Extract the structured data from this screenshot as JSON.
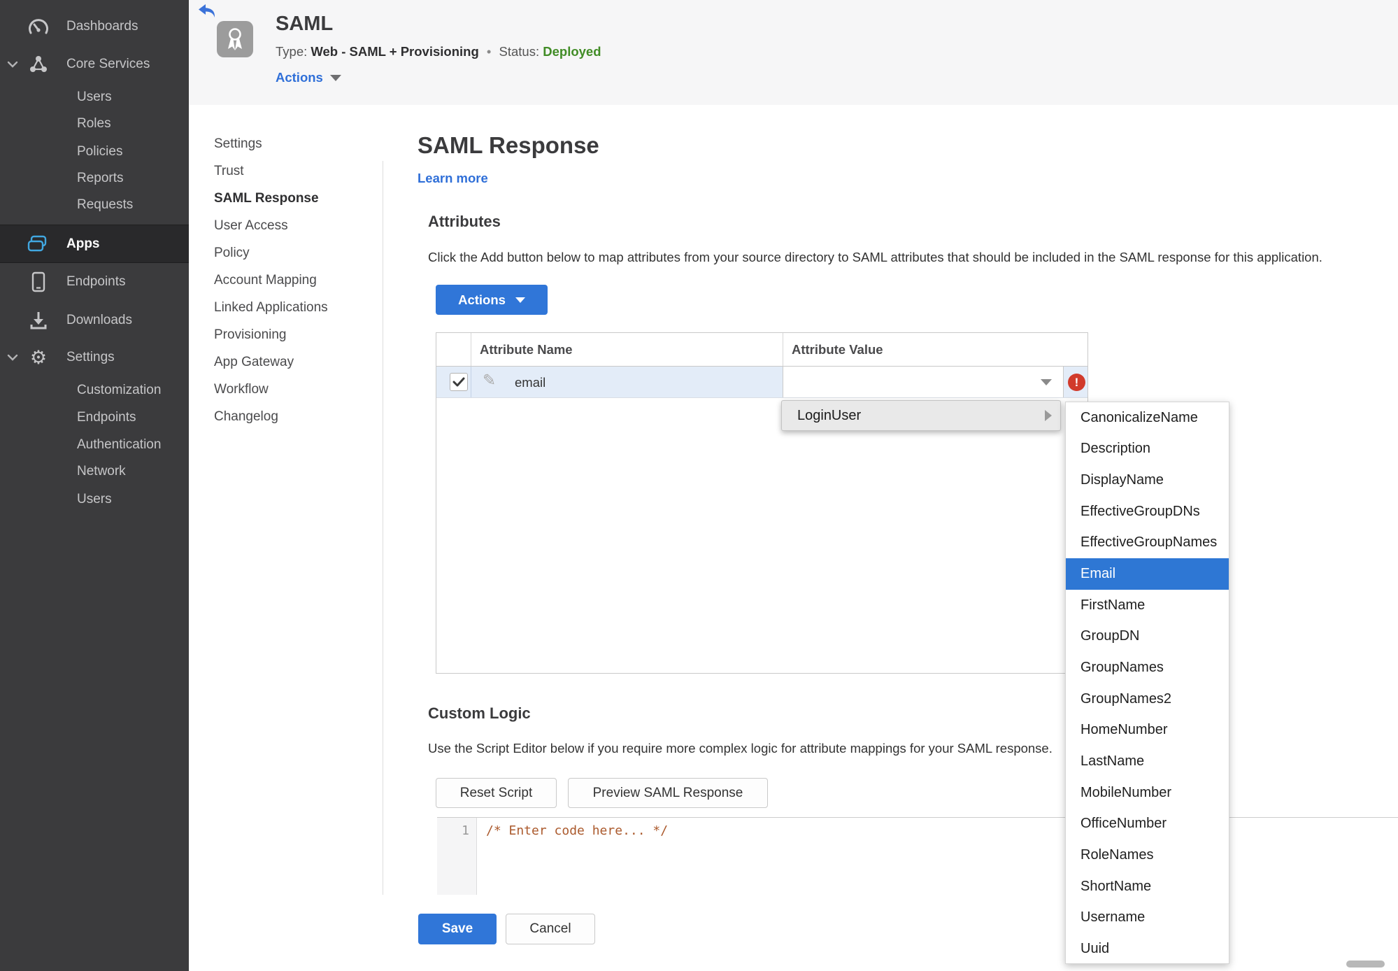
{
  "colors": {
    "sidebar_bg": "#3b3b3d",
    "sidebar_active_bg": "#29292b",
    "accent_blue": "#2f74d8",
    "apps_icon_blue": "#41a7e0",
    "deployed_green": "#418c26",
    "error_red": "#d13a2b",
    "selected_row_blue": "#e3ecf8",
    "submenu_selected_blue": "#2e77d4",
    "code_comment_brown": "#ab5a2d"
  },
  "icons": {
    "back": "reply-left-arrow",
    "app": "ribbon-award",
    "dashboards": "gauge",
    "core_services": "node-triangle",
    "apps": "stacked-windows",
    "endpoints": "smartphone",
    "downloads": "download-tray",
    "settings": "gear",
    "expand": "chevron-down",
    "edit": "pencil",
    "error": "exclamation-circle",
    "dropdown": "caret-down",
    "submenu": "caret-right"
  },
  "sidebar": {
    "active_item": "Apps",
    "items": [
      {
        "label": "Dashboards"
      },
      {
        "label": "Core Services"
      },
      {
        "label": "Users"
      },
      {
        "label": "Roles"
      },
      {
        "label": "Policies"
      },
      {
        "label": "Reports"
      },
      {
        "label": "Requests"
      },
      {
        "label": "Apps"
      },
      {
        "label": "Endpoints"
      },
      {
        "label": "Downloads"
      },
      {
        "label": "Settings"
      },
      {
        "label": "Customization"
      },
      {
        "label": "Endpoints"
      },
      {
        "label": "Authentication"
      },
      {
        "label": "Network"
      },
      {
        "label": "Users"
      }
    ]
  },
  "header": {
    "title": "SAML",
    "type_label": "Type:",
    "type_value": "Web - SAML + Provisioning",
    "separator": "•",
    "status_label": "Status:",
    "status_value": "Deployed",
    "actions_label": "Actions"
  },
  "nav": {
    "active": "SAML Response",
    "items": [
      {
        "label": "Settings"
      },
      {
        "label": "Trust"
      },
      {
        "label": "SAML Response"
      },
      {
        "label": "User Access"
      },
      {
        "label": "Policy"
      },
      {
        "label": "Account Mapping"
      },
      {
        "label": "Linked Applications"
      },
      {
        "label": "Provisioning"
      },
      {
        "label": "App Gateway"
      },
      {
        "label": "Workflow"
      },
      {
        "label": "Changelog"
      }
    ]
  },
  "main": {
    "title": "SAML Response",
    "learn_more": "Learn more",
    "attributes": {
      "heading": "Attributes",
      "description": "Click the Add button below to map attributes from your source directory to SAML attributes that should be included in the SAML response for this application.",
      "actions_button": "Actions",
      "table": {
        "columns": [
          "Attribute Name",
          "Attribute Value"
        ],
        "rows": [
          {
            "name": "email",
            "value": "",
            "checked": true,
            "error": true
          }
        ]
      }
    },
    "dropdown_menu": {
      "label": "LoginUser"
    },
    "submenu": {
      "selected": "Email",
      "items": [
        "CanonicalizeName",
        "Description",
        "DisplayName",
        "EffectiveGroupDNs",
        "EffectiveGroupNames",
        "Email",
        "FirstName",
        "GroupDN",
        "GroupNames",
        "GroupNames2",
        "HomeNumber",
        "LastName",
        "MobileNumber",
        "OfficeNumber",
        "RoleNames",
        "ShortName",
        "Username",
        "Uuid"
      ]
    },
    "custom_logic": {
      "heading": "Custom Logic",
      "description": "Use the Script Editor below if you require more complex logic for attribute mappings for your SAML response.",
      "reset_button": "Reset Script",
      "preview_button": "Preview SAML Response",
      "editor": {
        "line_number": "1",
        "code": "/* Enter code here... */"
      }
    },
    "footer": {
      "save": "Save",
      "cancel": "Cancel"
    }
  }
}
